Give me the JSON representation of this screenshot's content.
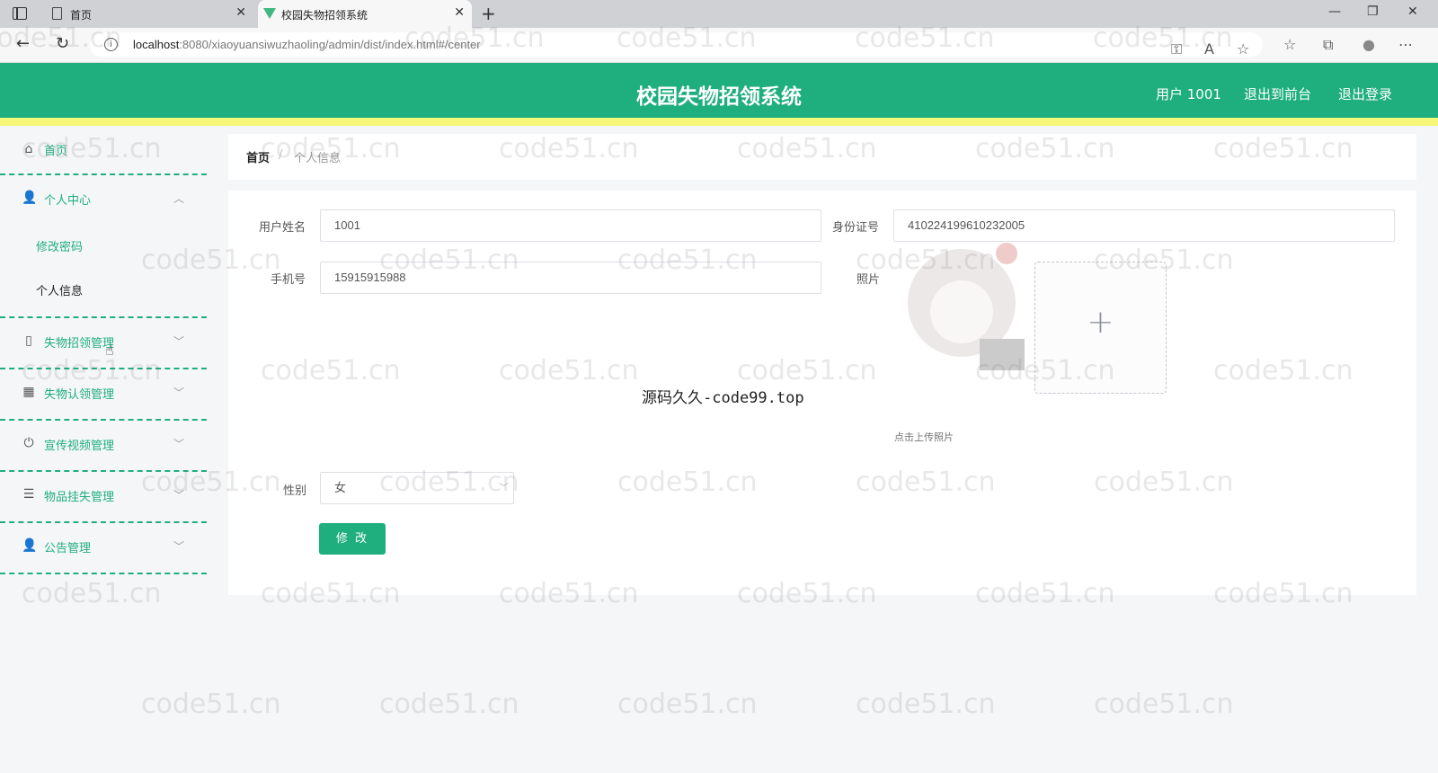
{
  "browser": {
    "tabs": [
      {
        "label": "首页"
      },
      {
        "label": "校园失物招领系统"
      }
    ],
    "url_host": "localhost",
    "url_rest": ":8080/xiaoyuansiwuzhaoling/admin/dist/index.html#/center"
  },
  "header": {
    "title": "校园失物招领系统",
    "user": "用户 1001",
    "to_front": "退出到前台",
    "logout": "退出登录"
  },
  "sidebar": {
    "items": [
      {
        "label": "首页",
        "icon": "home-icon"
      },
      {
        "label": "个人中心",
        "icon": "user-icon"
      },
      {
        "label": "失物招领管理",
        "icon": "mobile-icon"
      },
      {
        "label": "失物认领管理",
        "icon": "grid-icon"
      },
      {
        "label": "宣传视频管理",
        "icon": "power-icon"
      },
      {
        "label": "物品挂失管理",
        "icon": "list-icon"
      },
      {
        "label": "公告管理",
        "icon": "user-icon"
      }
    ],
    "submenu": [
      {
        "label": "修改密码"
      },
      {
        "label": "个人信息"
      }
    ]
  },
  "breadcrumb": {
    "home": "首页",
    "sep": "/",
    "current": "个人信息"
  },
  "form": {
    "username_label": "用户姓名",
    "username_value": "1001",
    "idcard_label": "身份证号",
    "idcard_value": "410224199610232005",
    "phone_label": "手机号",
    "phone_value": "15915915988",
    "photo_label": "照片",
    "upload_tip": "点击上传照片",
    "gender_label": "性别",
    "gender_value": "女",
    "submit": "修 改"
  },
  "overlay_text": "源码久久-code99.top",
  "watermark": "code51.cn",
  "colors": {
    "primary": "#1fae7e",
    "header_stripe": "#f4f778"
  }
}
